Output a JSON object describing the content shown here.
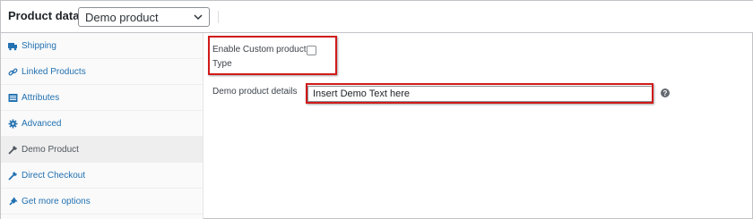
{
  "header": {
    "title": "Product data —",
    "product_type_value": "Demo product"
  },
  "sidebar": {
    "items": [
      {
        "label": "Shipping",
        "icon": "truck-icon"
      },
      {
        "label": "Linked Products",
        "icon": "link-icon"
      },
      {
        "label": "Attributes",
        "icon": "list-icon"
      },
      {
        "label": "Advanced",
        "icon": "gear-icon"
      },
      {
        "label": "Demo Product",
        "icon": "wrench-icon",
        "active": true
      },
      {
        "label": "Direct Checkout",
        "icon": "wrench-icon"
      },
      {
        "label": "Get more options",
        "icon": "plugin-icon"
      }
    ]
  },
  "main": {
    "enable_custom_label_line1": "Enable Custom product",
    "enable_custom_label_line2": "Type",
    "enable_custom_checked": false,
    "details_label": "Demo product details",
    "details_value": "Insert Demo Text here",
    "help_glyph": "?"
  },
  "colors": {
    "link": "#2271b1",
    "highlight": "#d11a1a"
  }
}
